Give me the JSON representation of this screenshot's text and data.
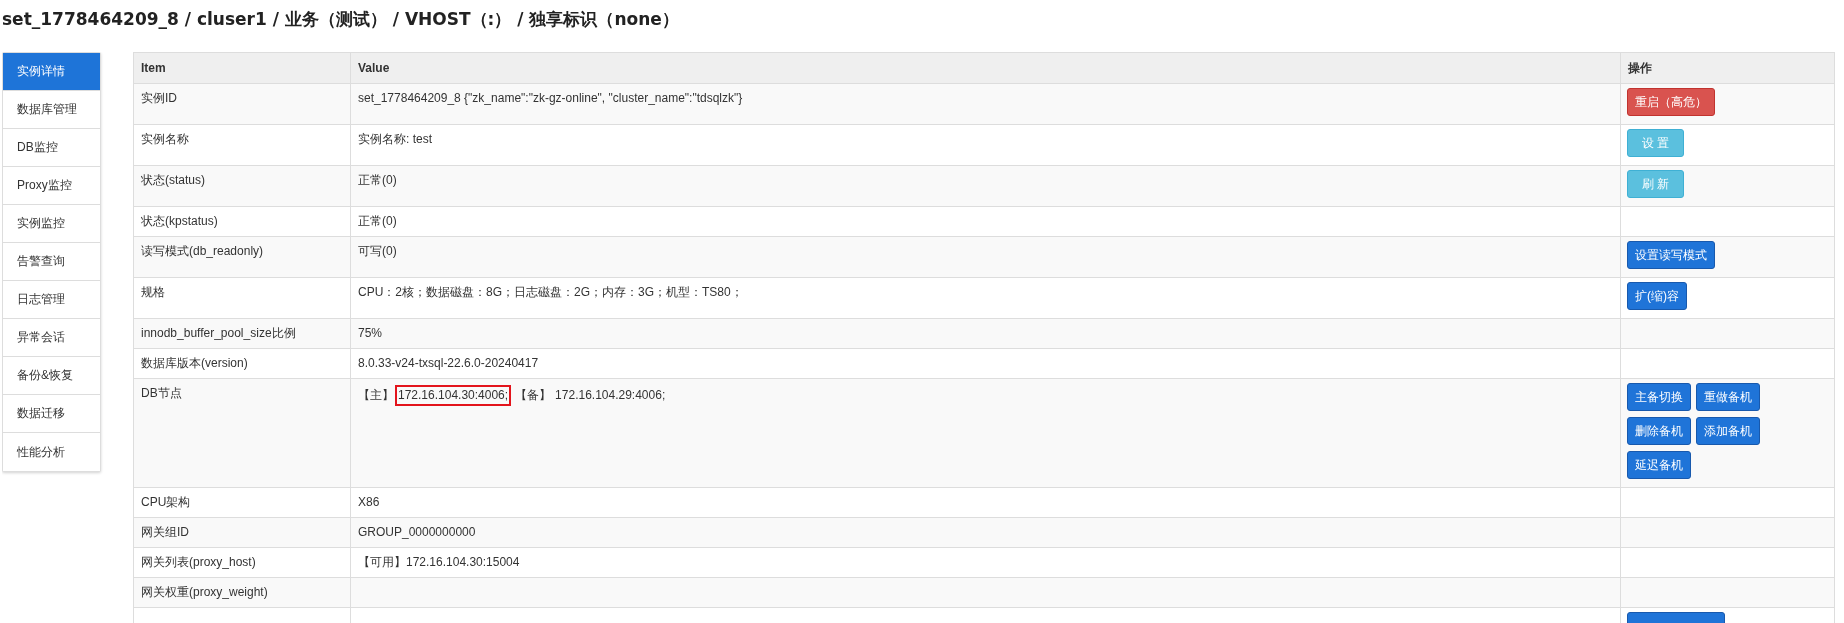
{
  "title": "set_1778464209_8 / cluser1 / 业务（测试） / VHOST（:） / 独享标识（none）",
  "sidebar": {
    "items": [
      {
        "label": "实例详情",
        "selected": true
      },
      {
        "label": "数据库管理",
        "selected": false
      },
      {
        "label": "DB监控",
        "selected": false
      },
      {
        "label": "Proxy监控",
        "selected": false
      },
      {
        "label": "实例监控",
        "selected": false
      },
      {
        "label": "告警查询",
        "selected": false
      },
      {
        "label": "日志管理",
        "selected": false
      },
      {
        "label": "异常会话",
        "selected": false
      },
      {
        "label": "备份&恢复",
        "selected": false
      },
      {
        "label": "数据迁移",
        "selected": false
      },
      {
        "label": "性能分析",
        "selected": false
      }
    ]
  },
  "table": {
    "columns": [
      "Item",
      "Value",
      "操作"
    ],
    "rows": [
      {
        "item": "实例ID",
        "value": "set_1778464209_8 {\"zk_name\":\"zk-gz-online\", \"cluster_name\":\"tdsqlzk\"}",
        "actions": [
          {
            "label": "重启（高危）",
            "kind": "danger"
          }
        ]
      },
      {
        "item": "实例名称",
        "value": "实例名称: test",
        "actions": [
          {
            "label": "设 置",
            "kind": "info"
          }
        ]
      },
      {
        "item": "状态(status)",
        "value": "正常(0)",
        "actions": [
          {
            "label": "刷 新",
            "kind": "info"
          }
        ]
      },
      {
        "item": "状态(kpstatus)",
        "value": "正常(0)"
      },
      {
        "item": "读写模式(db_readonly)",
        "value": "可写(0)",
        "actions": [
          {
            "label": "设置读写模式",
            "kind": "primary"
          }
        ]
      },
      {
        "item": "规格",
        "value": "CPU：2核；数据磁盘：8G；日志磁盘：2G；内存：3G；机型：TS80；",
        "actions": [
          {
            "label": "扩(缩)容",
            "kind": "primary"
          }
        ]
      },
      {
        "item": "innodb_buffer_pool_size比例",
        "value": "75%"
      },
      {
        "item": "数据库版本(version)",
        "value": "8.0.33-v24-txsql-22.6.0-20240417"
      },
      {
        "item": "DB节点",
        "nodes": [
          {
            "role": "【主】",
            "address": "172.16.104.30:4006;",
            "highlighted": true
          },
          {
            "role": "【备】",
            "address": "172.16.104.29:4006;",
            "highlighted": false
          }
        ],
        "actions": [
          {
            "label": "主备切换",
            "kind": "primary"
          },
          {
            "label": "重做备机",
            "kind": "primary"
          },
          {
            "label": "删除备机",
            "kind": "primary"
          },
          {
            "label": "添加备机",
            "kind": "primary"
          },
          {
            "label": "延迟备机",
            "kind": "primary"
          }
        ]
      },
      {
        "item": "CPU架构",
        "value": "X86"
      },
      {
        "item": "网关组ID",
        "value": "GROUP_0000000000"
      },
      {
        "item": "网关列表(proxy_host)",
        "value": "【可用】172.16.104.30:15004"
      },
      {
        "item": "网关权重(proxy_weight)"
      },
      {
        "actions": [
          {
            "kind": "primary"
          }
        ]
      }
    ]
  }
}
